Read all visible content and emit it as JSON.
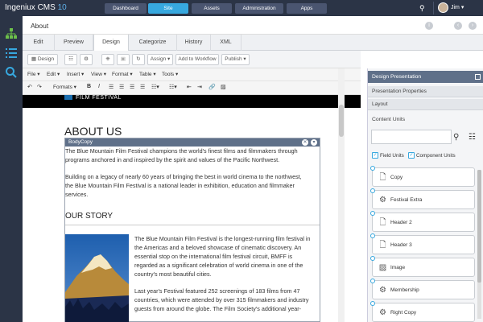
{
  "app": {
    "name": "Ingeniux CMS",
    "version": "10"
  },
  "topnav": [
    {
      "label": "Dashboard",
      "active": false
    },
    {
      "label": "Site",
      "active": true
    },
    {
      "label": "Assets",
      "active": false
    },
    {
      "label": "Administration",
      "active": false
    },
    {
      "label": "Apps",
      "active": false
    }
  ],
  "user": {
    "name": "Jim ▾"
  },
  "page": {
    "title": "About"
  },
  "tabs": [
    "Edit",
    "Preview",
    "Design",
    "Categorize",
    "History",
    "XML"
  ],
  "active_tab": "Design",
  "actionbar": {
    "design": "Design",
    "assign": "Assign ▾",
    "workflow": "Add to Workflow",
    "publish": "Publish ▾"
  },
  "menubar": [
    "File ▾",
    "Edit ▾",
    "Insert ▾",
    "View ▾",
    "Format ▾",
    "Table ▾",
    "Tools ▾"
  ],
  "formatbar": {
    "formats": "Formats ▾"
  },
  "content": {
    "banner": "FILM FESTIVAL",
    "heading": "ABOUT US",
    "component_label": "BodyCopy",
    "para1": [
      "The Blue Mountain Film Festival champions the world's finest films and filmmakers through",
      "programs anchored in and inspired by the spirit and values of the Pacific Northwest."
    ],
    "para2": [
      "Building on a legacy of nearly 60 years of bringing the best in world cinema to the northwest,",
      "the Blue Mountain Film Festival is a national leader in exhibition, education and filmmaker",
      "services."
    ],
    "story_heading": "OUR STORY",
    "story1": [
      "The Blue Mountain Film Festival is the longest-running film festival in",
      "the Americas and a beloved showcase of cinematic discovery. An",
      "essential stop on the international film festival circuit, BMFF is",
      "regarded as a significant celebration of world cinema in one of the",
      "country's most beautiful cities."
    ],
    "story2": [
      "Last year's Festival featured 252 screenings of 183 films from 47",
      "countries, which were attended by over 315 filmmakers and industry",
      "guests from around the globe. The Film Society's additional year-"
    ]
  },
  "right_panel": {
    "header": "Design Presentation",
    "rows": [
      "Presentation Properties",
      "Layout"
    ],
    "content_units_label": "Content Units",
    "field_units": "Field Units",
    "component_units": "Component Units",
    "units": [
      {
        "label": "Copy",
        "icon": "document-icon"
      },
      {
        "label": "Festival Extra",
        "icon": "gear-icon"
      },
      {
        "label": "Header 2",
        "icon": "document-icon"
      },
      {
        "label": "Header 3",
        "icon": "document-icon"
      },
      {
        "label": "Image",
        "icon": "image-icon"
      },
      {
        "label": "Membership",
        "icon": "gear-icon"
      },
      {
        "label": "Right Copy",
        "icon": "gear-icon"
      }
    ]
  },
  "colors": {
    "topbar": "#2b3446",
    "accent": "#37a8df",
    "panel_header": "#5f7089",
    "sidebar_green": "#6cc04a",
    "sidebar_blue": "#37a8df"
  }
}
